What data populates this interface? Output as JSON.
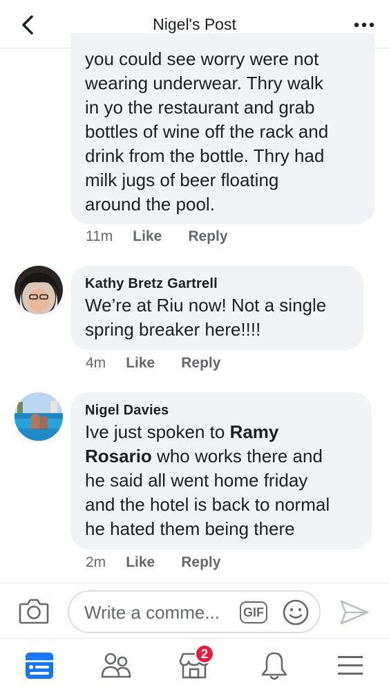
{
  "header": {
    "title": "Nigel's Post",
    "back_icon": "chevron-left-icon",
    "more_icon": "more-horizontal-icon"
  },
  "comments": [
    {
      "author": "",
      "text_lines": [
        "you could see worry were not",
        "wearing underwear. Thry walk",
        "in yo the restaurant and grab",
        "bottles of wine off the rack and",
        "drink from the bottle.  Thry had",
        "milk jugs of beer floating",
        "around the pool."
      ],
      "time": "11m",
      "like_label": "Like",
      "reply_label": "Reply"
    },
    {
      "author": "Kathy Bretz Gartrell",
      "text_lines": [
        "We’re at Riu now! Not a single",
        "spring breaker here!!!!"
      ],
      "time": "4m",
      "like_label": "Like",
      "reply_label": "Reply"
    },
    {
      "author": "Nigel Davies",
      "text_lines": [
        "Ive just spoken to ",
        "Ramy",
        "Rosario",
        " who works there and",
        "he said all went home friday",
        "and the hotel is back to normal",
        "he hated them being there"
      ],
      "time": "2m",
      "like_label": "Like",
      "reply_label": "Reply"
    }
  ],
  "composer": {
    "placeholder": "Write a comme...",
    "gif_label": "GIF",
    "camera_icon": "camera-icon",
    "emoji_icon": "smiley-icon",
    "send_icon": "send-icon"
  },
  "tabbar": {
    "items": [
      {
        "name": "news-feed",
        "icon": "news-feed-icon",
        "active": true
      },
      {
        "name": "groups",
        "icon": "groups-icon"
      },
      {
        "name": "marketplace",
        "icon": "marketplace-icon",
        "badge": "2"
      },
      {
        "name": "notifications",
        "icon": "bell-icon"
      },
      {
        "name": "menu",
        "icon": "menu-icon"
      }
    ]
  },
  "colors": {
    "accent": "#1877f2",
    "bubble": "#f0f2f5",
    "secondary_text": "#65676b",
    "badge": "#e41e3f"
  }
}
